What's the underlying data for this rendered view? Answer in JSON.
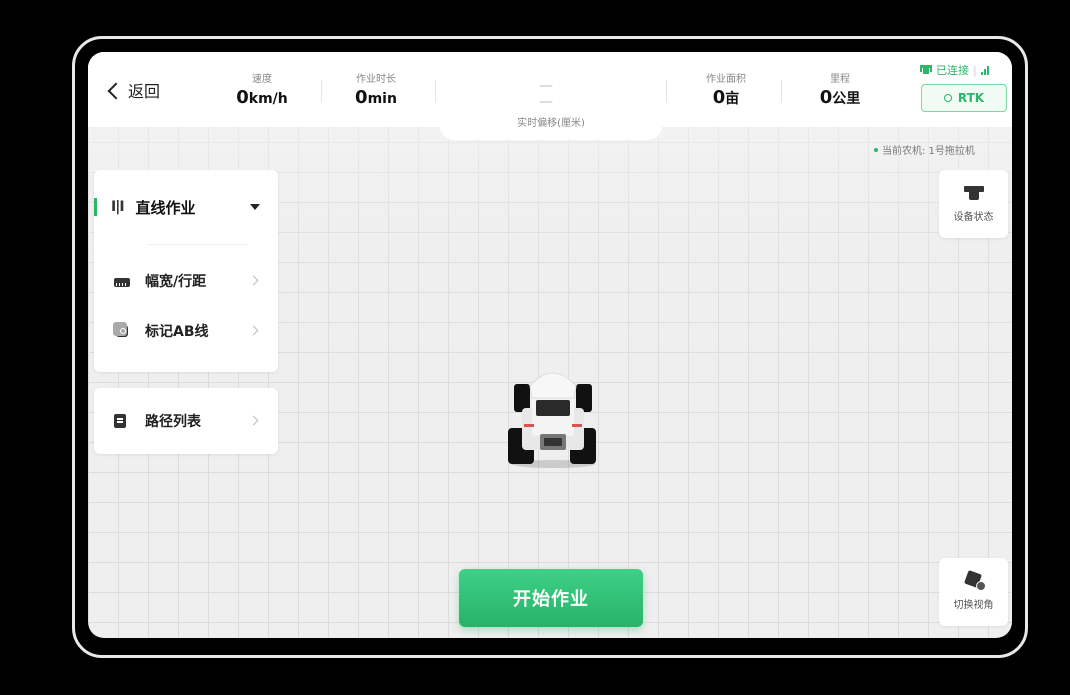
{
  "header": {
    "back_label": "返回",
    "stats": [
      {
        "label": "速度",
        "value": "0",
        "unit": "km/h"
      },
      {
        "label": "作业时长",
        "value": "0",
        "unit": "min"
      },
      {
        "label": "作业面积",
        "value": "0",
        "unit": "亩"
      },
      {
        "label": "里程",
        "value": "0",
        "unit": "公里"
      }
    ],
    "offset": {
      "value": "— —",
      "label": "实时偏移(厘米)"
    },
    "connection": {
      "status": "已连接",
      "icon": "tractor-icon",
      "signal_icon": "signal-icon"
    },
    "rtk_label": "RTK",
    "current_machine": "当前农机: 1号拖拉机"
  },
  "left_panel": {
    "mode": {
      "icon": "straight-line-icon",
      "glyph": "Ⅰ|Ⅰ",
      "label": "直线作业"
    },
    "items": [
      {
        "icon": "ruler-icon",
        "label": "幅宽/行距"
      },
      {
        "icon": "ab-line-icon",
        "label": "标记AB线"
      }
    ],
    "route_list": {
      "icon": "list-icon",
      "label": "路径列表"
    }
  },
  "right_buttons": {
    "device_status": {
      "icon": "device-status-icon",
      "label": "设备状态"
    },
    "switch_view": {
      "icon": "switch-view-icon",
      "label": "切换视角"
    }
  },
  "start_button": "开始作业",
  "colors": {
    "accent": "#2db56a",
    "start_button": "#2fbf72"
  }
}
